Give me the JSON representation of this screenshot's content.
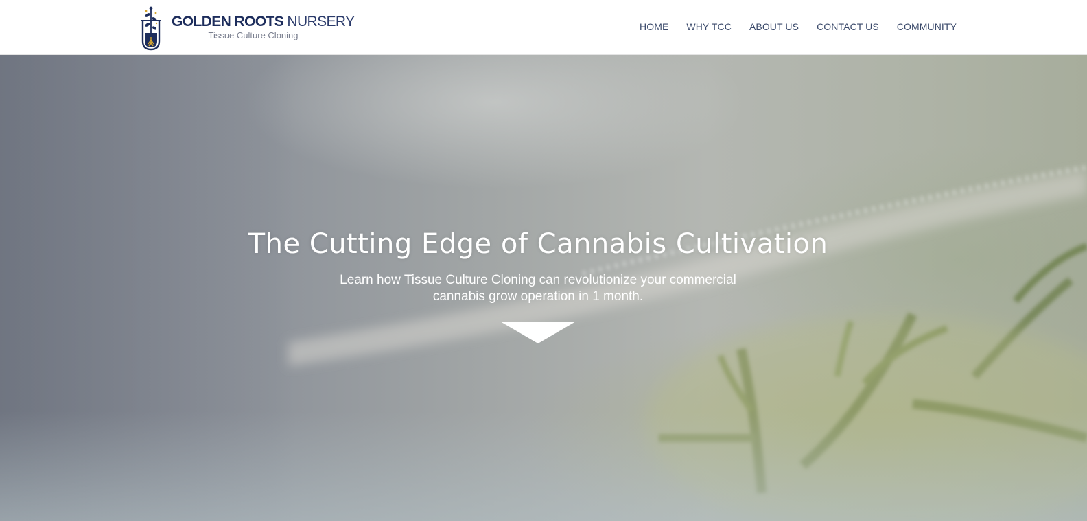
{
  "header": {
    "brand_bold": "GOLDEN ROOTS",
    "brand_light": " NURSERY",
    "tagline": "Tissue Culture Cloning",
    "logo_icon": "test-tube-plant-icon"
  },
  "nav": {
    "items": [
      {
        "label": "HOME"
      },
      {
        "label": "WHY TCC"
      },
      {
        "label": "ABOUT US"
      },
      {
        "label": "CONTACT US"
      },
      {
        "label": "COMMUNITY"
      }
    ]
  },
  "hero": {
    "title": "The Cutting Edge of Cannabis Cultivation",
    "subtitle": "Learn how Tissue Culture Cloning can revolutionize your commercial cannabis grow operation in 1 month.",
    "scroll_icon": "down-triangle-icon"
  },
  "colors": {
    "brand_navy": "#1d2d5c",
    "nav_text": "#3b4a6b",
    "hero_text": "#ffffff",
    "header_bg": "#ffffff"
  }
}
